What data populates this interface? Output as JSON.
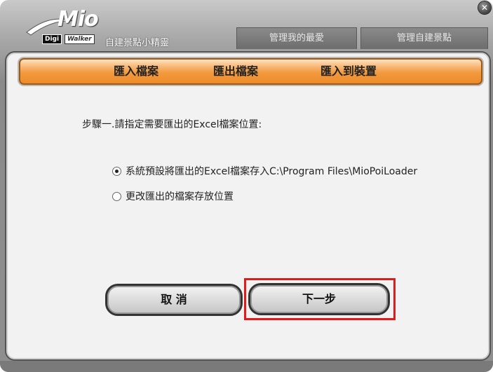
{
  "app": {
    "logo_text": "Mio",
    "digi": "Digi",
    "walker": "Walker",
    "title": "自建景點小精靈",
    "close_glyph": "✕"
  },
  "top_tabs": [
    {
      "label": "管理我的最愛"
    },
    {
      "label": "管理自建景點"
    }
  ],
  "menu": [
    {
      "label": "匯入檔案"
    },
    {
      "label": "匯出檔案"
    },
    {
      "label": "匯入到裝置"
    }
  ],
  "content": {
    "step": "步驟一.請指定需要匯出的Excel檔案位置:",
    "options": [
      {
        "label": "系統預設將匯出的Excel檔案存入C:\\Program Files\\MioPoiLoader",
        "selected": true
      },
      {
        "label": "更改匯出的檔案存放位置",
        "selected": false
      }
    ]
  },
  "buttons": {
    "cancel": "取 消",
    "next": "下一步"
  },
  "colors": {
    "menubar": "#f29a3e",
    "highlight": "#e11b1b",
    "panel_bg": "#f2f2f2"
  }
}
